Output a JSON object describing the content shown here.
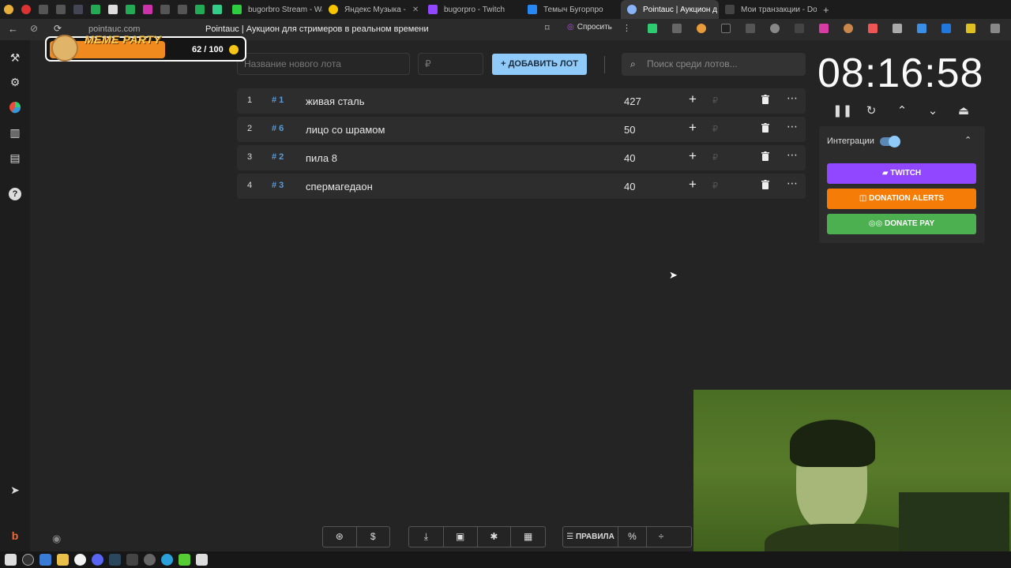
{
  "browser": {
    "tabs": [
      {
        "label": "bugorbro Stream - Watc",
        "color": "#2ecc40"
      },
      {
        "label": "Яндекс Музыка -",
        "color": "#f7c400"
      },
      {
        "label": "bugorpro - Twitch",
        "color": "#9146ff"
      },
      {
        "label": "Темыч Бугорпро",
        "color": "#2787f5"
      },
      {
        "label": "Pointauc | Аукцион д",
        "color": "#8ab4f8",
        "active": true
      },
      {
        "label": "Мои транзакции - Don",
        "color": "#444444"
      }
    ],
    "url": "pointauc.com",
    "page_title": "Pointauc | Аукцион для стримеров в реальном времени",
    "ask_label": "Спросить"
  },
  "overlay": {
    "title": "MEME PARTY",
    "progress_text": "62 / 100",
    "progress_fraction": 0.62
  },
  "toolbar": {
    "lot_name_placeholder": "Название нового лота",
    "amount_placeholder": "₽",
    "add_label": "ДОБАВИТЬ ЛОТ",
    "search_placeholder": "Поиск среди лотов..."
  },
  "lots": [
    {
      "index": "1",
      "fast_id": "# 1",
      "name": "живая сталь",
      "amount": "427",
      "currency": "₽"
    },
    {
      "index": "2",
      "fast_id": "# 6",
      "name": "лицо со шрамом",
      "amount": "50",
      "currency": "₽"
    },
    {
      "index": "3",
      "fast_id": "# 2",
      "name": "пила 8",
      "amount": "40",
      "currency": "₽"
    },
    {
      "index": "4",
      "fast_id": "# 3",
      "name": "спермагедаон",
      "amount": "40",
      "currency": "₽"
    }
  ],
  "timer": {
    "value": "08:16:58"
  },
  "integrations": {
    "label": "Интеграции",
    "enabled": true,
    "buttons": [
      {
        "label": "TWITCH",
        "color": "#9146ff"
      },
      {
        "label": "DONATION ALERTS",
        "color": "#f57d07"
      },
      {
        "label": "DONATE PAY",
        "color": "#4caf50"
      }
    ]
  },
  "bottom": {
    "rules_label": "ПРАВИЛА",
    "percent_label": "%"
  }
}
